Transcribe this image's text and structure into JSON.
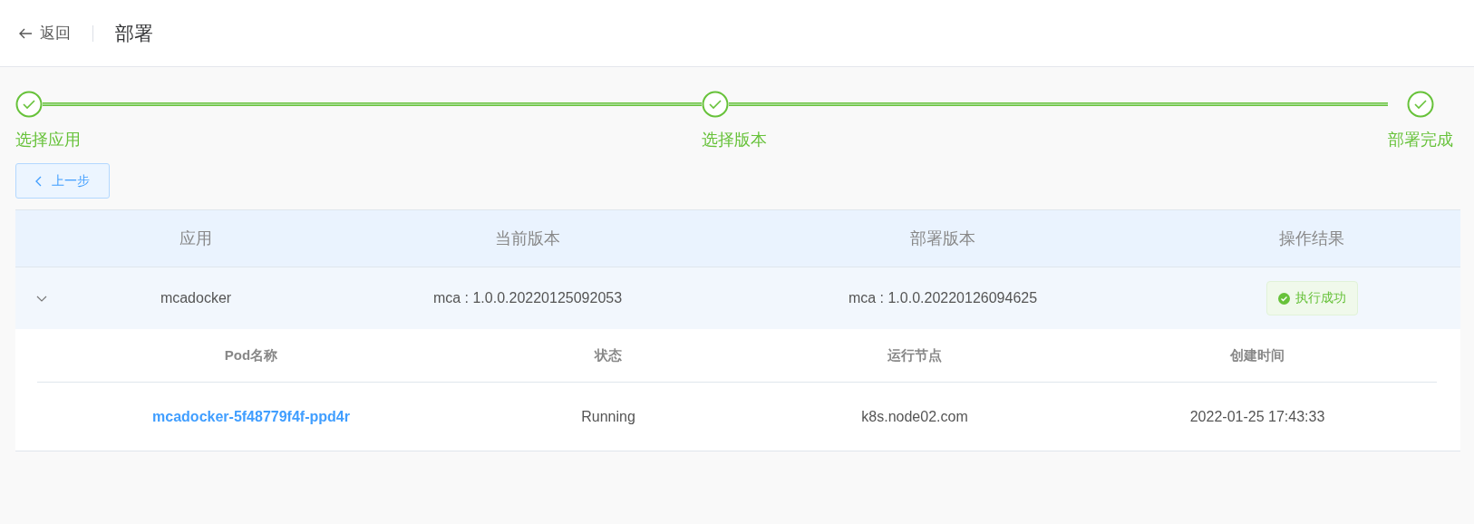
{
  "header": {
    "back_label": "返回",
    "title": "部署"
  },
  "steps": [
    {
      "label": "选择应用",
      "done": true
    },
    {
      "label": "选择版本",
      "done": true
    },
    {
      "label": "部署完成",
      "done": true
    }
  ],
  "prev_button": "上一步",
  "table": {
    "columns": [
      "应用",
      "当前版本",
      "部署版本",
      "操作结果"
    ],
    "rows": [
      {
        "expanded": true,
        "cells": [
          "mcadocker",
          "mca : 1.0.0.20220125092053",
          "mca : 1.0.0.20220126094625"
        ],
        "result": {
          "kind": "success",
          "label": "执行成功"
        },
        "pods": {
          "columns": [
            "Pod名称",
            "状态",
            "运行节点",
            "创建时间"
          ],
          "rows": [
            {
              "name": "mcadocker-5f48779f4f-ppd4r",
              "status": "Running",
              "node": "k8s.node02.com",
              "created": "2022-01-25 17:43:33"
            }
          ]
        }
      }
    ]
  }
}
